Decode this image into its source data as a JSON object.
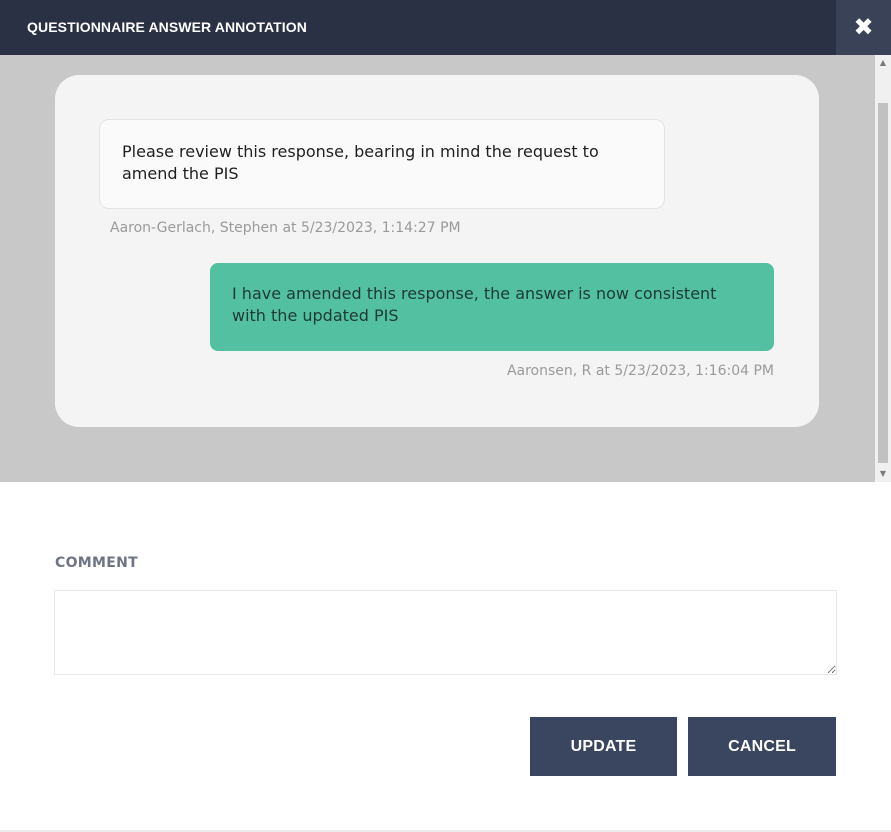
{
  "header": {
    "title": "QUESTIONNAIRE ANSWER ANNOTATION",
    "close_icon": "✖"
  },
  "thread": {
    "messages": [
      {
        "text": "Please review this response, bearing in mind the request to amend the PIS",
        "meta": "Aaron-Gerlach, Stephen at 5/23/2023, 1:14:27 PM",
        "side": "left"
      },
      {
        "text": "I have amended this response, the answer is now consistent with the updated PIS",
        "meta": "Aaronsen, R at 5/23/2023, 1:16:04 PM",
        "side": "right"
      }
    ]
  },
  "scrollbar": {
    "up_icon": "▲",
    "down_icon": "▼"
  },
  "comment": {
    "label": "COMMENT",
    "value": "",
    "placeholder": ""
  },
  "buttons": {
    "update_label": "UPDATE",
    "cancel_label": "CANCEL"
  },
  "colors": {
    "header_bg": "#2a3145",
    "accent_bubble": "#53c0a2",
    "button_bg": "#3a4560"
  }
}
